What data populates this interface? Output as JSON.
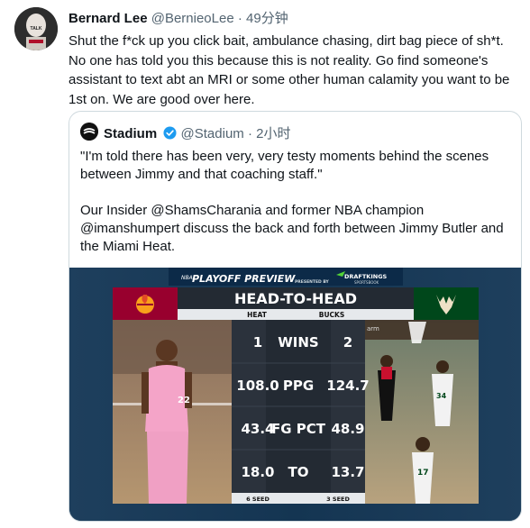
{
  "tweet": {
    "author_name": "Bernard Lee",
    "author_handle": "@BernieoLee",
    "separator": "·",
    "time": "49分钟",
    "text": "Shut the f*ck up you click bait, ambulance chasing, dirt bag piece of sh*t. No one has told you this because this is not reality.  Go find someone's assistant to text abt an MRI or some other human calamity you want to be 1st on.  We are good over here."
  },
  "quoted_tweet": {
    "author_name": "Stadium",
    "author_handle": "@Stadium",
    "separator": "·",
    "time": "2小时",
    "text_paragraph_1": "\"I'm told there has been very, very testy moments behind the scenes between Jimmy and that coaching staff.\"",
    "text_paragraph_2": "Our Insider @ShamsCharania and former NBA champion @imanshumpert discuss the back and forth between Jimmy Butler and the Miami Heat."
  },
  "media": {
    "banner_title": "PLAYOFF PREVIEW",
    "banner_small": "NBA",
    "presented_by": "PRESENTED BY",
    "sponsor": "DRAFTKINGS",
    "sponsor_sub": "SPORTSBOOK",
    "table_title": "HEAD-TO-HEAD",
    "team_left": "HEAT",
    "team_right": "BUCKS",
    "rows": [
      {
        "left": "1",
        "stat": "WINS",
        "right": "2"
      },
      {
        "left": "108.0",
        "stat": "PPG",
        "right": "124.7"
      },
      {
        "left": "43.4",
        "stat": "FG PCT",
        "right": "48.9"
      },
      {
        "left": "18.0",
        "stat": "TO",
        "right": "13.7"
      }
    ],
    "seed_left": "6 SEED",
    "seed_right": "3 SEED",
    "avatar_caption": "TALK",
    "court_text": "arm",
    "colors": {
      "heat": "#98002e",
      "bucks": "#00471b",
      "table": "#232a33",
      "banner": "#0c2a48"
    }
  }
}
